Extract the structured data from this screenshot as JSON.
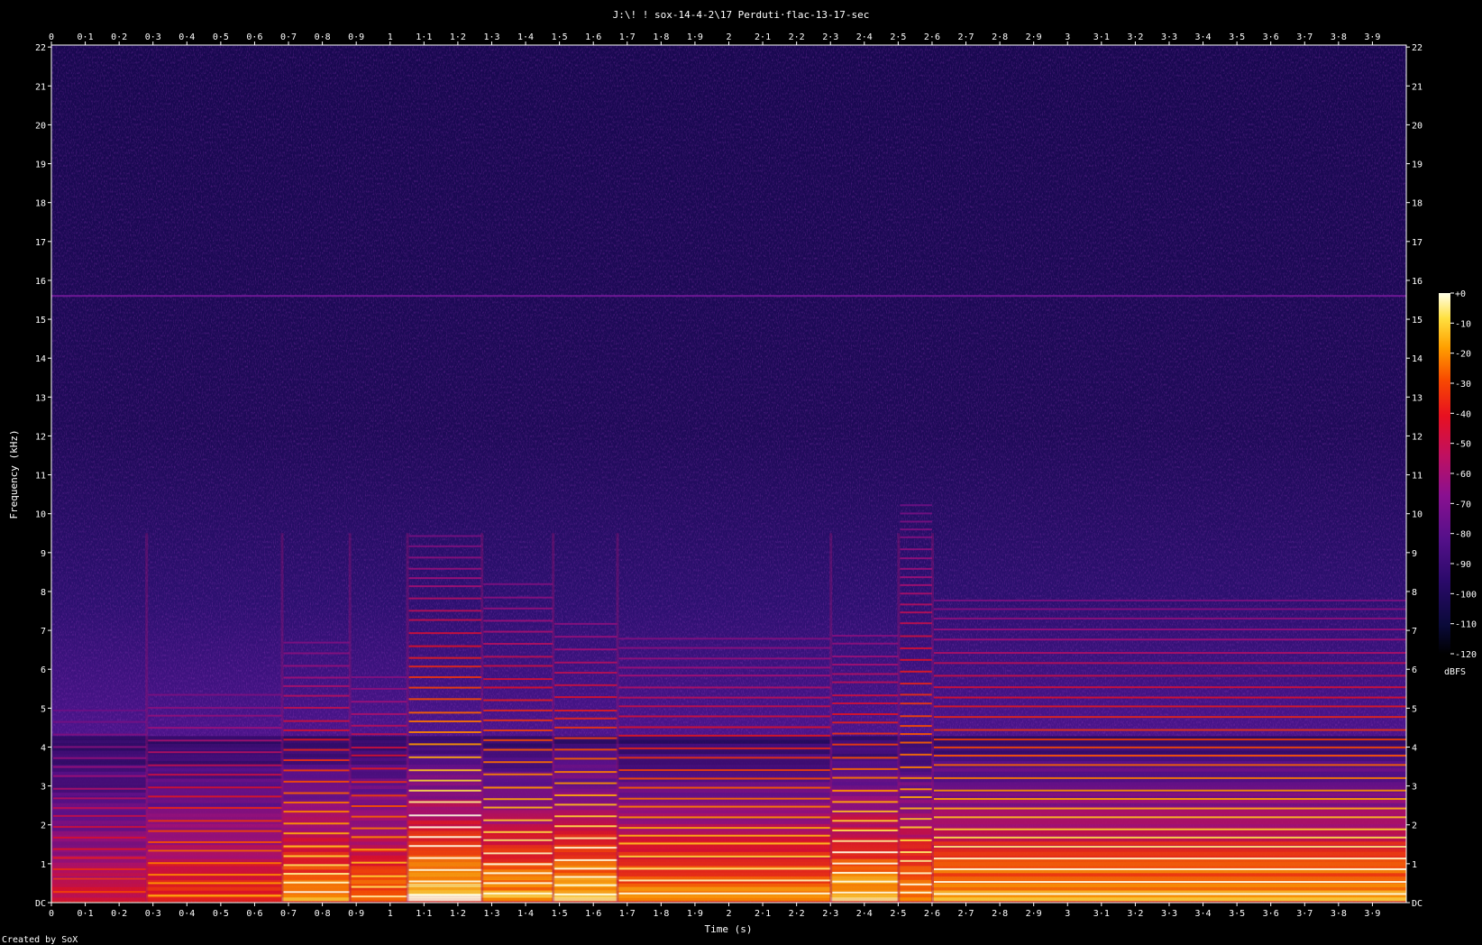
{
  "chart_data": {
    "type": "heatmap",
    "title": "J:\\! ! sox-14-4-2\\17 Perduti·flac-13-17-sec",
    "xlabel": "Time (s)",
    "ylabel": "Frequency (kHz)",
    "footer": "Created by SoX",
    "x_ticks": [
      "0",
      "0·1",
      "0·2",
      "0·3",
      "0·4",
      "0·5",
      "0·6",
      "0·7",
      "0·8",
      "0·9",
      "1",
      "1·1",
      "1·2",
      "1·3",
      "1·4",
      "1·5",
      "1·6",
      "1·7",
      "1·8",
      "1·9",
      "2",
      "2·1",
      "2·2",
      "2·3",
      "2·4",
      "2·5",
      "2·6",
      "2·7",
      "2·8",
      "2·9",
      "3",
      "3·1",
      "3·2",
      "3·3",
      "3·4",
      "3·5",
      "3·6",
      "3·7",
      "3·8",
      "3·9"
    ],
    "y_ticks": [
      "DC",
      "1",
      "2",
      "3",
      "4",
      "5",
      "6",
      "7",
      "8",
      "9",
      "10",
      "11",
      "12",
      "13",
      "14",
      "15",
      "16",
      "17",
      "18",
      "19",
      "20",
      "21",
      "22"
    ],
    "xlim": [
      0,
      4.0
    ],
    "ylim": [
      0,
      22.05
    ],
    "colorbar": {
      "unit": "dBFS",
      "ticks": [
        "+0",
        "-10",
        "-20",
        "-30",
        "-40",
        "-50",
        "-60",
        "-70",
        "-80",
        "-90",
        "-100",
        "-110",
        "-120"
      ],
      "range": [
        -120,
        0
      ]
    },
    "features": {
      "constant_tone_khz": 15.6,
      "note_onsets_s": [
        0.28,
        0.68,
        0.88,
        1.05,
        1.27,
        1.48,
        1.67,
        2.3,
        2.5,
        2.6
      ]
    }
  }
}
